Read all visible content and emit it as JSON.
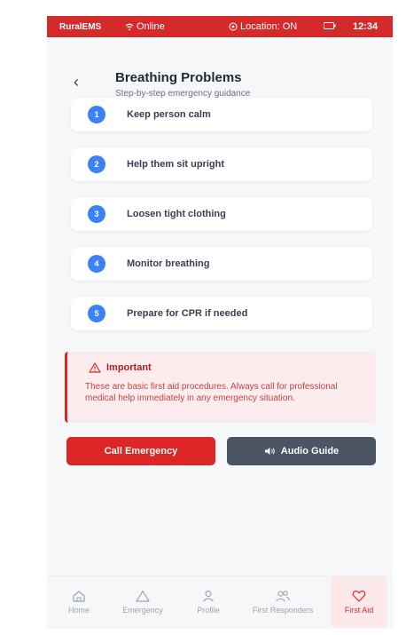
{
  "status_bar": {
    "app_name": "RuralEMS",
    "network": "Online",
    "location": "Location: ON",
    "time": "12:34"
  },
  "header": {
    "title": "Breathing Problems",
    "subtitle": "Step-by-step emergency guidance"
  },
  "steps": [
    {
      "number": "1",
      "text": "Keep person calm"
    },
    {
      "number": "2",
      "text": "Help them sit upright"
    },
    {
      "number": "3",
      "text": "Loosen tight clothing"
    },
    {
      "number": "4",
      "text": "Monitor breathing"
    },
    {
      "number": "5",
      "text": "Prepare for CPR if needed"
    }
  ],
  "alert": {
    "title": "Important",
    "body": "These are basic first aid procedures. Always call for professional medical help immediately in any emergency situation."
  },
  "actions": {
    "call_label": "Call Emergency",
    "audio_label": "Audio Guide"
  },
  "nav": [
    {
      "label": "Home",
      "icon": "home-icon"
    },
    {
      "label": "Emergency",
      "icon": "warning-icon"
    },
    {
      "label": "Profile",
      "icon": "user-icon"
    },
    {
      "label": "First Responders",
      "icon": "users-icon"
    },
    {
      "label": "First Aid",
      "icon": "heart-icon",
      "active": true
    }
  ],
  "colors": {
    "brand_red": "#d42a2a",
    "step_blue": "#3b82f6",
    "audio_gray": "#4b5563"
  }
}
